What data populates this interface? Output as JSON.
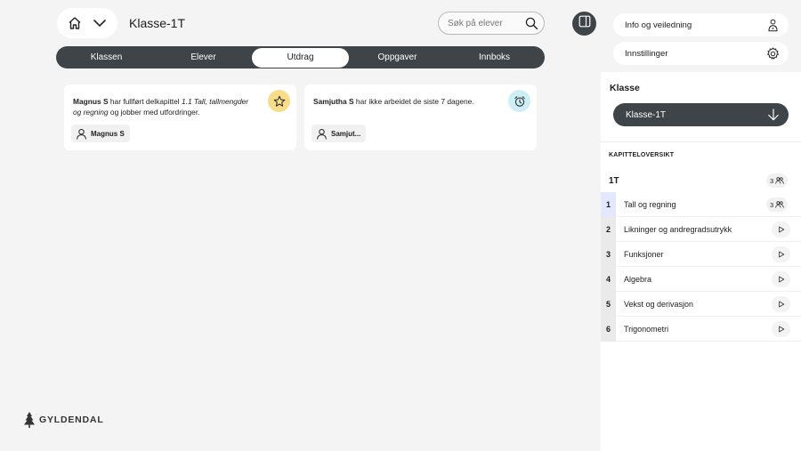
{
  "header": {
    "class_title": "Klasse-1T",
    "search_placeholder": "Søk på elever"
  },
  "tabs": [
    {
      "label": "Klassen",
      "active": false
    },
    {
      "label": "Elever",
      "active": false
    },
    {
      "label": "Utdrag",
      "active": true
    },
    {
      "label": "Oppgaver",
      "active": false
    },
    {
      "label": "Innboks",
      "active": false
    }
  ],
  "cards": [
    {
      "name": "Magnus S",
      "pre": " har fullført delkapittel ",
      "chapter": "1.1 Tall, tallmengder og regning",
      "post": " og jobber med utfordringer.",
      "chip": "Magnus S",
      "badge": "star-icon"
    },
    {
      "name": "Samjutha S",
      "pre": " har ikke arbeidet de siste 7 dagene.",
      "chip": "Samjut...",
      "badge": "alarm-clock-icon"
    }
  ],
  "brand": "GYLDENDAL",
  "sidebar": {
    "info_label": "Info og veiledning",
    "settings_label": "Innstillinger",
    "klasse_label": "Klasse",
    "klasse_value": "Klasse-1T",
    "kapittel_header": "KAPITTELOVERSIKT",
    "course": "1T",
    "course_count": "3",
    "chapters": [
      {
        "num": "1",
        "title": "Tall og regning",
        "count": "3"
      },
      {
        "num": "2",
        "title": "Likninger og andregradsutrykk"
      },
      {
        "num": "3",
        "title": "Funksjoner"
      },
      {
        "num": "4",
        "title": "Algebra"
      },
      {
        "num": "5",
        "title": "Vekst og derivasjon"
      },
      {
        "num": "6",
        "title": "Trigonometri"
      }
    ]
  },
  "colors": {
    "dark": "#3e4448",
    "star_badge": "#f7dd8a",
    "alarm_badge": "#cdeef5",
    "chapter_highlight": "#e4e8ff"
  }
}
